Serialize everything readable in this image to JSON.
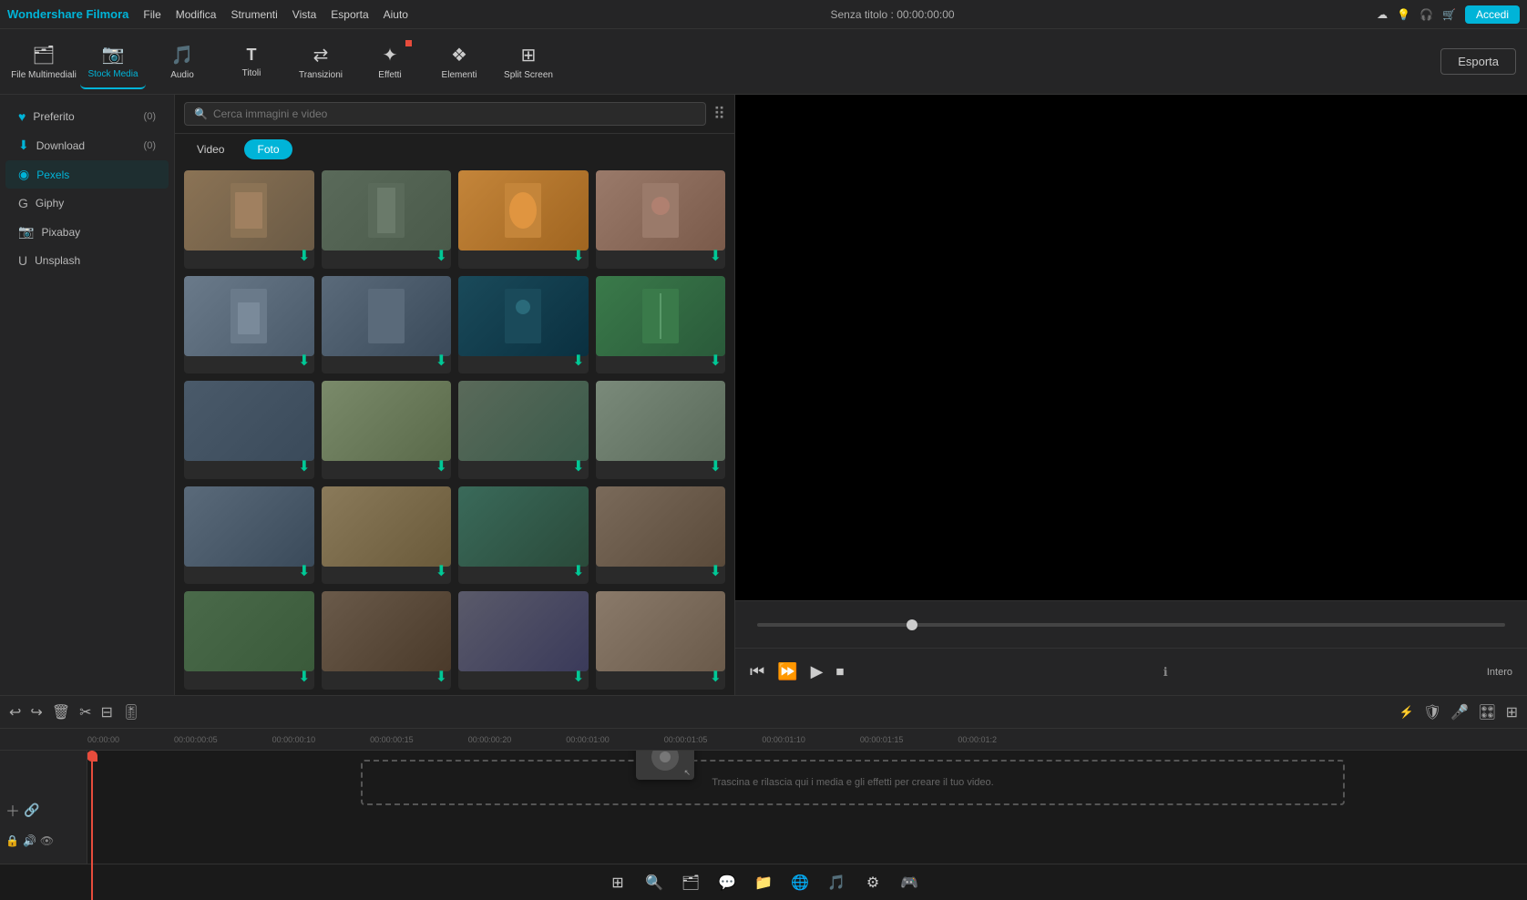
{
  "titlebar": {
    "app_name": "Wondershare Filmora",
    "menu": [
      "File",
      "Modifica",
      "Strumenti",
      "Vista",
      "Esporta",
      "Aiuto"
    ],
    "project_title": "Senza titolo : 00:00:00:00",
    "accedi_label": "Accedi"
  },
  "toolbar": {
    "items": [
      {
        "id": "file-multimediali",
        "label": "File Multimediali",
        "icon": "🗂"
      },
      {
        "id": "stock-media",
        "label": "Stock Media",
        "icon": "📷",
        "active": true
      },
      {
        "id": "audio",
        "label": "Audio",
        "icon": "🎵"
      },
      {
        "id": "titoli",
        "label": "Titoli",
        "icon": "T"
      },
      {
        "id": "transizioni",
        "label": "Transizioni",
        "icon": "🔀"
      },
      {
        "id": "effetti",
        "label": "Effetti",
        "icon": "✨",
        "badge": true
      },
      {
        "id": "elementi",
        "label": "Elementi",
        "icon": "🎭"
      },
      {
        "id": "split-screen",
        "label": "Split Screen",
        "icon": "⊞"
      }
    ],
    "esporta_label": "Esporta"
  },
  "sidebar": {
    "items": [
      {
        "id": "preferito",
        "label": "Preferito",
        "count": "(0)",
        "icon": "♥",
        "active": false
      },
      {
        "id": "download",
        "label": "Download",
        "count": "(0)",
        "icon": "⬇",
        "active": false
      },
      {
        "id": "pexels",
        "label": "Pexels",
        "count": "",
        "icon": "P",
        "active": true
      },
      {
        "id": "giphy",
        "label": "Giphy",
        "count": "",
        "icon": "G",
        "active": false
      },
      {
        "id": "pixabay",
        "label": "Pixabay",
        "count": "",
        "icon": "📷",
        "active": false
      },
      {
        "id": "unsplash",
        "label": "Unsplash",
        "count": "",
        "icon": "U",
        "active": false
      }
    ]
  },
  "media_panel": {
    "search_placeholder": "Cerca immagini e video",
    "tabs": [
      {
        "id": "video",
        "label": "Video",
        "active": false
      },
      {
        "id": "foto",
        "label": "Foto",
        "active": true
      }
    ],
    "grid_items": [
      {
        "id": 1,
        "color": "#8b7355",
        "has_download": true
      },
      {
        "id": 2,
        "color": "#5a6a5a",
        "has_download": true
      },
      {
        "id": 3,
        "color": "#c4853a",
        "has_download": true
      },
      {
        "id": 4,
        "color": "#9a7a6a",
        "has_download": true
      },
      {
        "id": 5,
        "color": "#6a7a8a",
        "has_download": true
      },
      {
        "id": 6,
        "color": "#5a6a7a",
        "has_download": true
      },
      {
        "id": 7,
        "color": "#2a5a6a",
        "has_download": true
      },
      {
        "id": 8,
        "color": "#4a7a4a",
        "has_download": true
      },
      {
        "id": 9,
        "color": "#4a5a6a",
        "has_download": true
      },
      {
        "id": 10,
        "color": "#7a8a7a",
        "has_download": true
      },
      {
        "id": 11,
        "color": "#6a7a5a",
        "has_download": true
      },
      {
        "id": 12,
        "color": "#7a8a7a",
        "has_download": true
      },
      {
        "id": 13,
        "color": "#5a6a7a",
        "has_download": true
      },
      {
        "id": 14,
        "color": "#8a7a5a",
        "has_download": true
      },
      {
        "id": 15,
        "color": "#3a6a5a",
        "has_download": true
      },
      {
        "id": 16,
        "color": "#7a6a5a",
        "has_download": true
      },
      {
        "id": 17,
        "color": "#4a5a4a",
        "has_download": true
      },
      {
        "id": 18,
        "color": "#6a5a4a",
        "has_download": true
      },
      {
        "id": 19,
        "color": "#5a5a6a",
        "has_download": true
      },
      {
        "id": 20,
        "color": "#8a7a6a",
        "has_download": true
      }
    ]
  },
  "preview": {
    "playback_mode": "Intero"
  },
  "timeline": {
    "time_markers": [
      "00:00:00",
      "00:00:00:05",
      "00:00:00:10",
      "00:00:00:15",
      "00:00:00:20",
      "00:00:01:00",
      "00:00:01:05",
      "00:00:01:10",
      "00:00:01:15",
      "00:00:01:2"
    ],
    "drop_label": "Trascina e rilascia qui i media e gli effetti per creare il tuo video."
  },
  "taskbar": {
    "icons": [
      "⊞",
      "🔍",
      "🗂",
      "💬",
      "📁",
      "🌐",
      "🎵",
      "⚙",
      "🎮"
    ]
  }
}
